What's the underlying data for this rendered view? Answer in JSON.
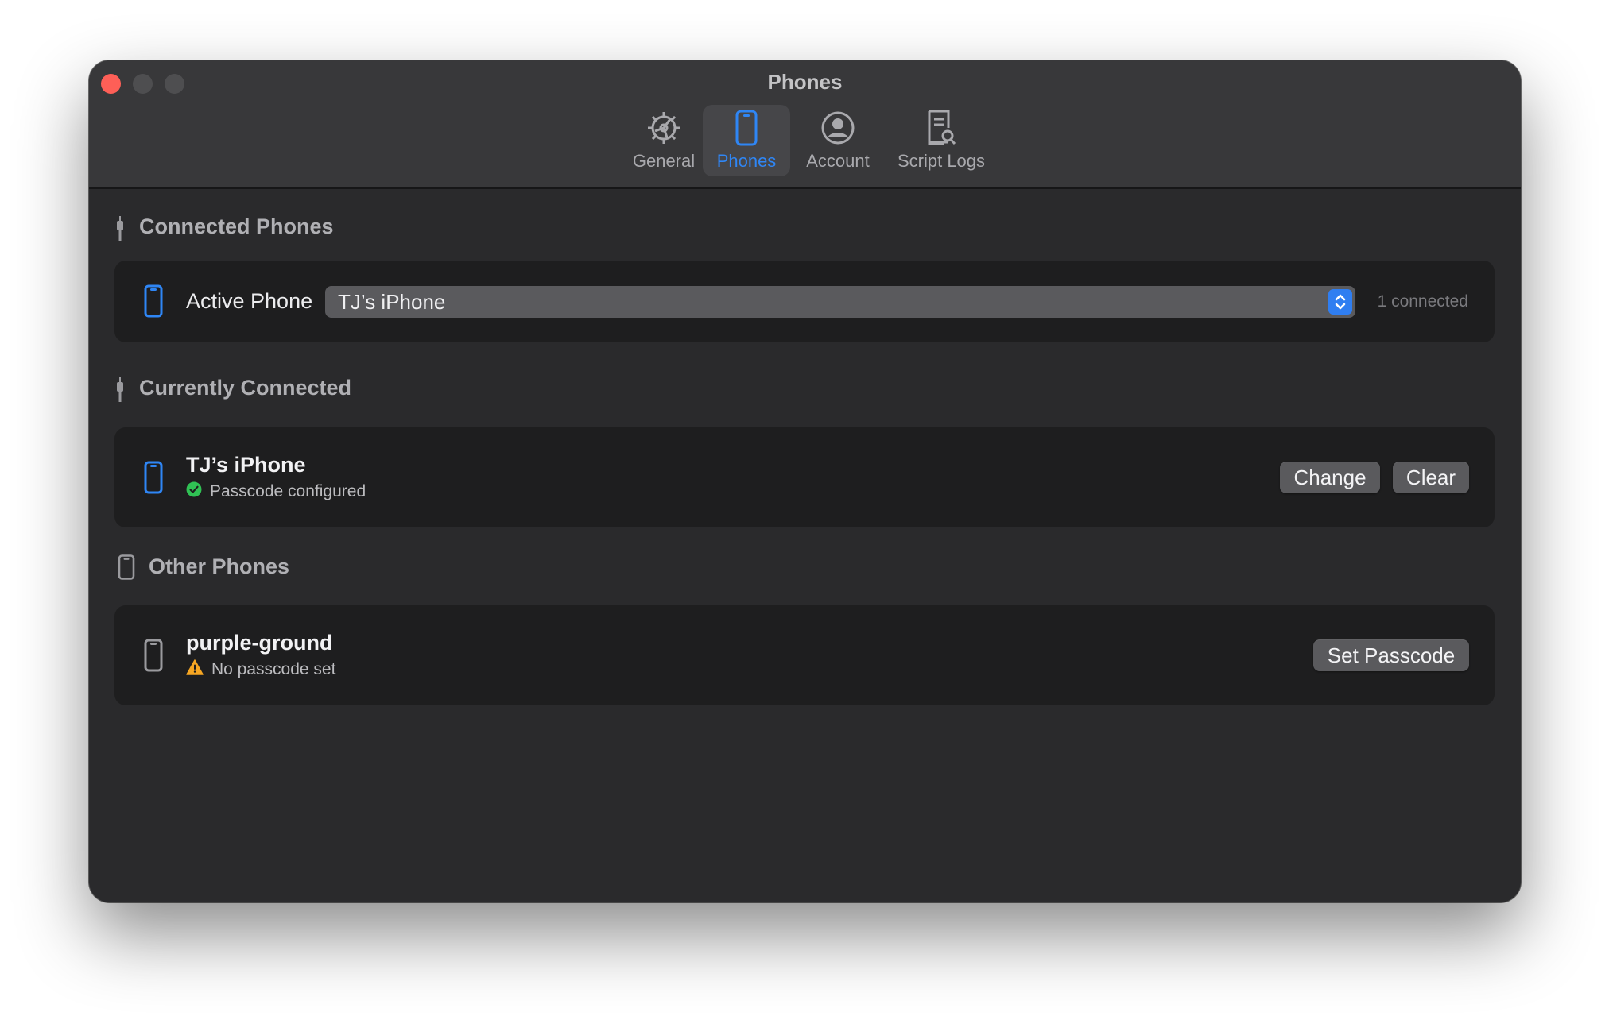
{
  "window": {
    "title": "Phones"
  },
  "toolbar": {
    "tabs": [
      {
        "label": "General",
        "icon": "gear-icon",
        "active": false
      },
      {
        "label": "Phones",
        "icon": "iphone-icon",
        "active": true
      },
      {
        "label": "Account",
        "icon": "person-circle-icon",
        "active": false
      },
      {
        "label": "Script Logs",
        "icon": "doc-magnifier-icon",
        "active": false
      }
    ]
  },
  "connected_phones": {
    "title": "Connected Phones",
    "icon": "cable-connector-icon",
    "active_phone_label": "Active Phone",
    "selected_phone": "TJ’s iPhone",
    "connected_count": "1 connected"
  },
  "currently_connected": {
    "title": "Currently Connected",
    "icon": "cable-connector-icon",
    "device": {
      "name": "TJ’s iPhone",
      "status": "Passcode configured",
      "status_icon": "checkmark-circle-icon",
      "change_label": "Change",
      "clear_label": "Clear"
    }
  },
  "other_phones": {
    "title": "Other Phones",
    "icon": "iphone-icon",
    "devices": [
      {
        "name": "purple-ground",
        "status": "No passcode set",
        "status_icon": "warning-triangle-icon",
        "action_label": "Set Passcode"
      }
    ]
  },
  "colors": {
    "accent": "#2f86f5",
    "success": "#30c254",
    "warning": "#f6a623",
    "close": "#fe5f57"
  }
}
